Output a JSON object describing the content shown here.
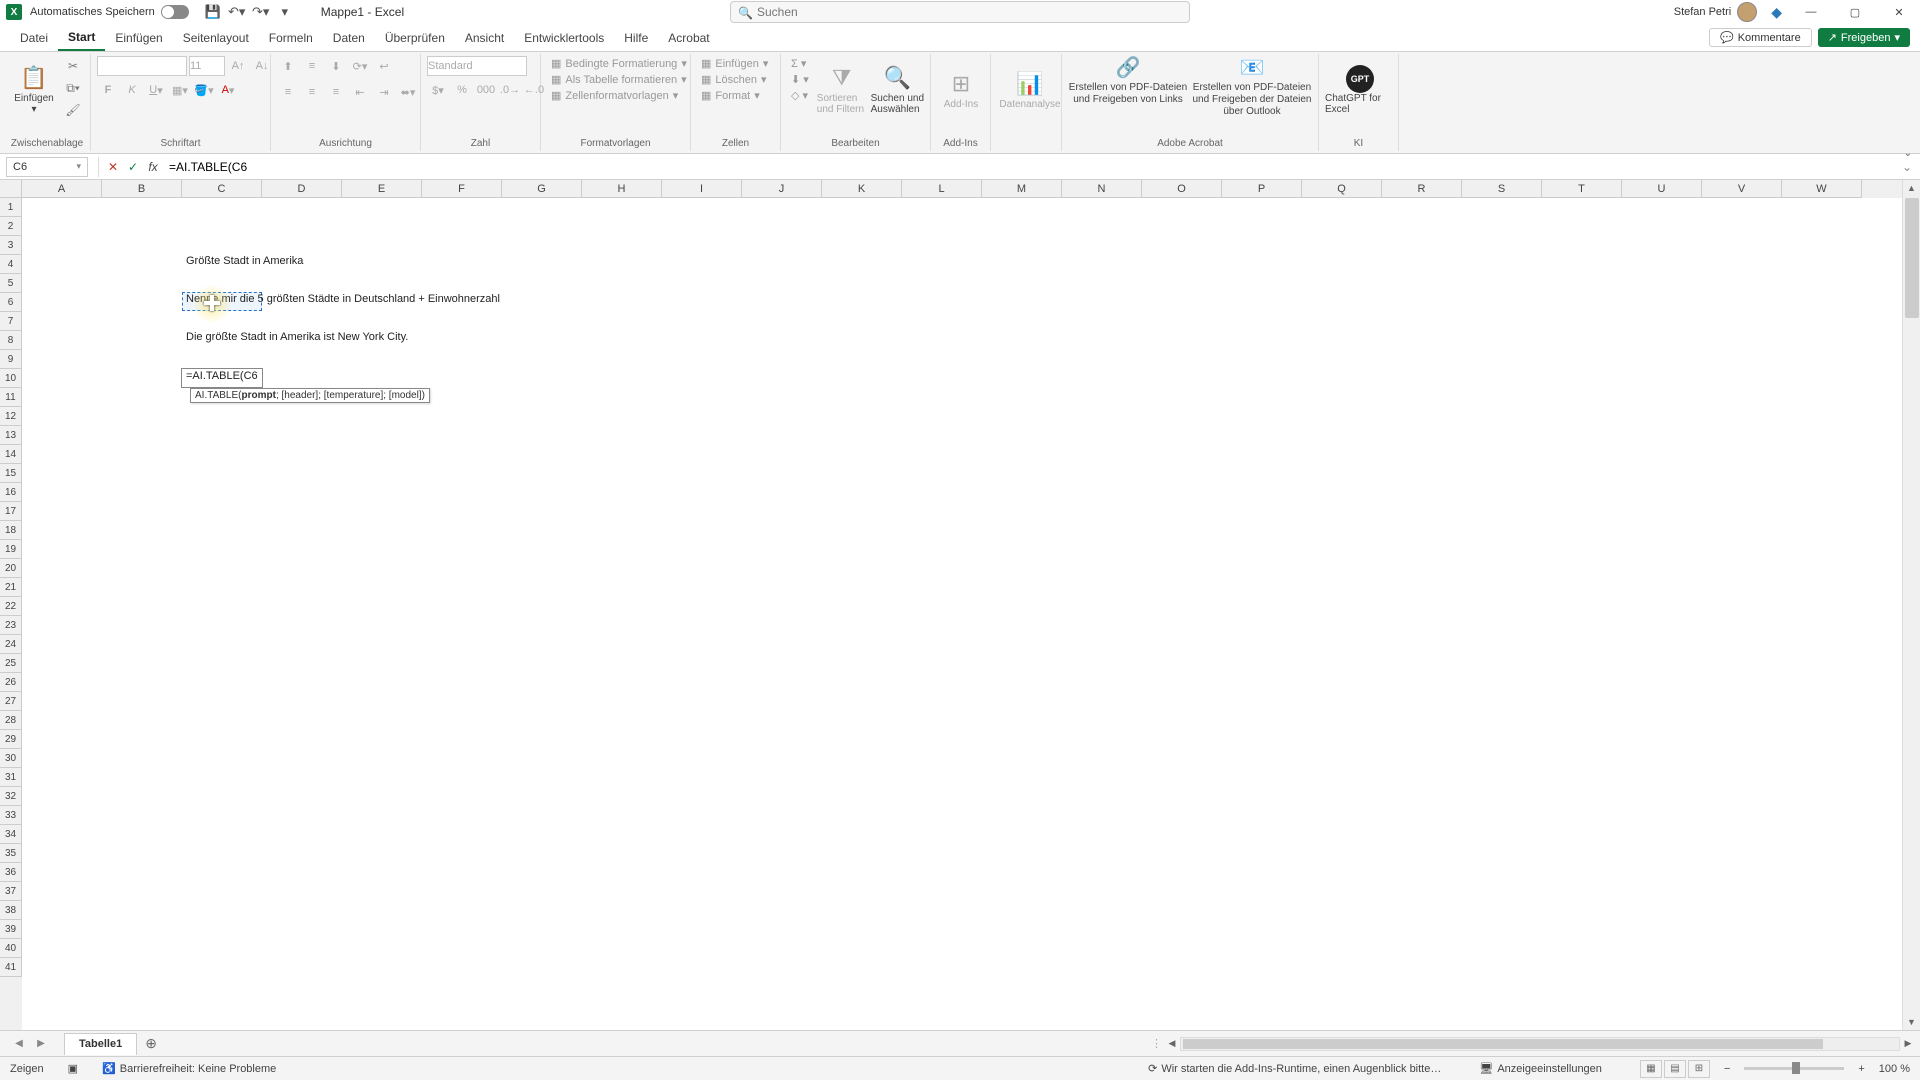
{
  "titlebar": {
    "autosave_label": "Automatisches Speichern",
    "filename": "Mappe1 - Excel",
    "search_placeholder": "Suchen",
    "user_name": "Stefan Petri"
  },
  "ribbon_tabs": {
    "items": [
      "Datei",
      "Start",
      "Einfügen",
      "Seitenlayout",
      "Formeln",
      "Daten",
      "Überprüfen",
      "Ansicht",
      "Entwicklertools",
      "Hilfe",
      "Acrobat"
    ],
    "active_index": 1,
    "comments": "Kommentare",
    "share": "Freigeben"
  },
  "ribbon_groups": {
    "clipboard": {
      "label": "Zwischenablage",
      "paste": "Einfügen"
    },
    "font": {
      "label": "Schriftart",
      "size": "11"
    },
    "alignment": {
      "label": "Ausrichtung"
    },
    "number": {
      "label": "Zahl",
      "format": "Standard"
    },
    "styles": {
      "label": "Formatvorlagen",
      "cond": "Bedingte Formatierung",
      "table": "Als Tabelle formatieren",
      "cell": "Zellenformatvorlagen"
    },
    "cells": {
      "label": "Zellen",
      "insert": "Einfügen",
      "delete": "Löschen",
      "format": "Format"
    },
    "editing": {
      "label": "Bearbeiten",
      "sort": "Sortieren und Filtern",
      "find": "Suchen und Auswählen"
    },
    "addins": {
      "label": "Add-Ins",
      "addins_btn": "Add-Ins",
      "analysis": "Datenanalyse"
    },
    "adobe": {
      "label": "Adobe Acrobat",
      "create_link": "Erstellen von PDF-Dateien und Freigeben von Links",
      "create_outlook": "Erstellen von PDF-Dateien und Freigeben der Dateien über Outlook"
    },
    "ai": {
      "label": "KI",
      "chatgpt": "ChatGPT for Excel"
    }
  },
  "formula_bar": {
    "cell_ref": "C6",
    "formula": "=AI.TABLE(C6"
  },
  "columns": [
    "A",
    "B",
    "C",
    "D",
    "E",
    "F",
    "G",
    "H",
    "I",
    "J",
    "K",
    "L",
    "M",
    "N",
    "O",
    "P",
    "Q",
    "R",
    "S",
    "T",
    "U",
    "V",
    "W"
  ],
  "cells": {
    "c4": "Größte Stadt in Amerika",
    "c6": "Nenne mir die 5 größten Städte in Deutschland + Einwohnerzahl",
    "c8": "Die größte Stadt in Amerika ist New York City.",
    "c10": "=AI.TABLE(C6",
    "tooltip_fn": "AI.TABLE(",
    "tooltip_args": "prompt; [header]; [temperature]; [model])"
  },
  "sheet_tabs": {
    "active": "Tabelle1"
  },
  "statusbar": {
    "mode": "Zeigen",
    "accessibility": "Barrierefreiheit: Keine Probleme",
    "runtime_msg": "Wir starten die Add-Ins-Runtime, einen Augenblick bitte…",
    "display_settings": "Anzeigeeinstellungen",
    "zoom": "100 %"
  }
}
